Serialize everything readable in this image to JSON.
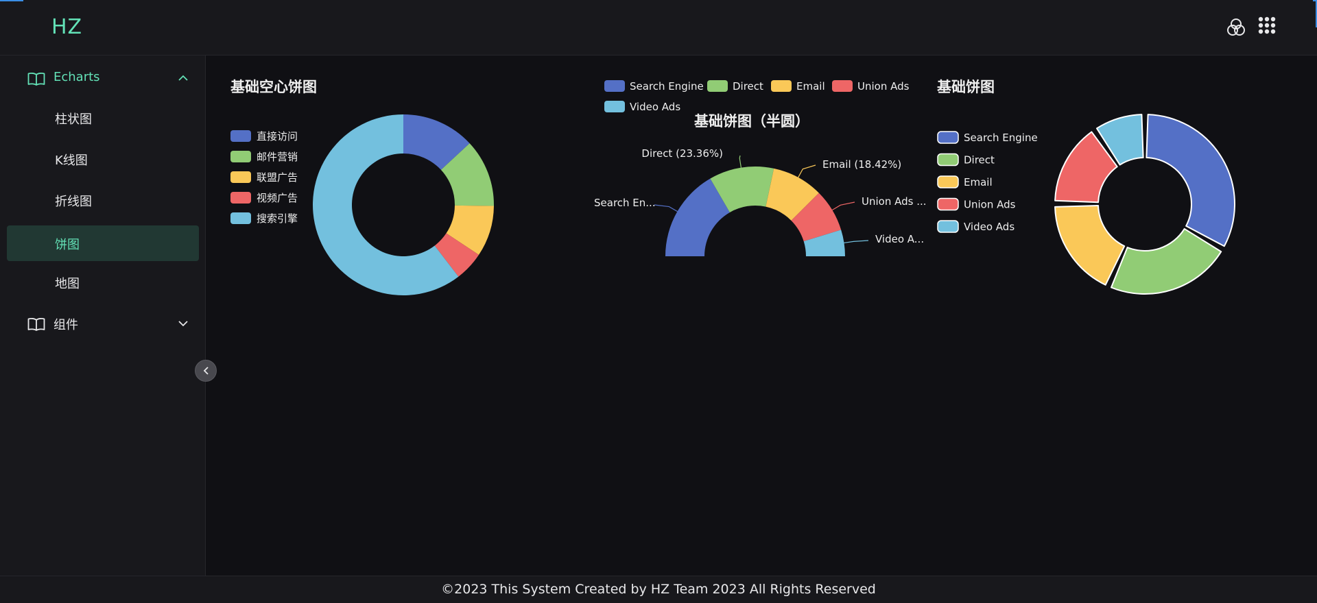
{
  "header": {
    "logo": "HZ",
    "icons": [
      "theme-icon",
      "apps-grid-icon"
    ]
  },
  "sidebar": {
    "groups": [
      {
        "label": "Echarts",
        "expanded": true,
        "icon": "book-icon",
        "items": [
          {
            "label": "柱状图",
            "active": false
          },
          {
            "label": "K线图",
            "active": false
          },
          {
            "label": "折线图",
            "active": false
          },
          {
            "label": "饼图",
            "active": true
          },
          {
            "label": "地图",
            "active": false
          }
        ]
      },
      {
        "label": "组件",
        "expanded": false,
        "icon": "book-icon",
        "items": []
      }
    ]
  },
  "colors": {
    "accent": "#63e2b7",
    "palette": [
      "#5470c6",
      "#91cc75",
      "#fac858",
      "#ee6666",
      "#73c0de"
    ]
  },
  "chart_data": [
    {
      "type": "pie",
      "variant": "donut",
      "title": "基础空心饼图",
      "legend": "left",
      "categories": [
        "直接访问",
        "邮件营销",
        "联盟广告",
        "视频广告",
        "搜索引擎"
      ],
      "values": [
        335,
        310,
        234,
        135,
        1548
      ]
    },
    {
      "type": "pie",
      "variant": "half-donut",
      "title": "基础饼图（半圆）",
      "legend": "top",
      "categories": [
        "Search Engine",
        "Direct",
        "Email",
        "Union Ads",
        "Video Ads"
      ],
      "values": [
        1048,
        735,
        580,
        484,
        300
      ],
      "labels": [
        "Search En...",
        "Direct (23.36%)",
        "Email (18.42%)",
        "Union Ads ...",
        "Video A..."
      ]
    },
    {
      "type": "pie",
      "variant": "rounded-donut",
      "title": "基础饼图",
      "legend": "left",
      "categories": [
        "Search Engine",
        "Direct",
        "Email",
        "Union Ads",
        "Video Ads"
      ],
      "values": [
        1048,
        735,
        580,
        484,
        300
      ]
    }
  ],
  "footer": {
    "text": "©2023 This System Created by HZ Team 2023 All Rights Reserved"
  }
}
